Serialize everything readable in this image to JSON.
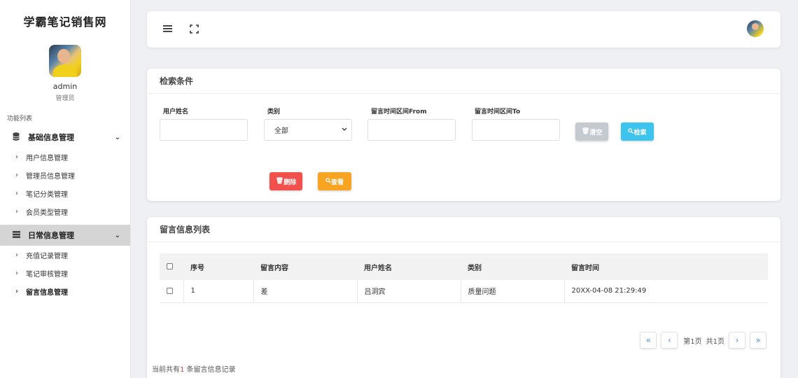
{
  "brand": "学霸笔记销售网",
  "user": {
    "name": "admin",
    "role": "管理员"
  },
  "menu_caption": "功能列表",
  "menu": {
    "groups": [
      {
        "label": "基础信息管理",
        "icon": "database-icon",
        "items": [
          "用户信息管理",
          "管理员信息管理",
          "笔记分类管理",
          "会员类型管理"
        ]
      },
      {
        "label": "日常信息管理",
        "icon": "server-icon",
        "items": [
          "充值记录管理",
          "笔记审核管理",
          "留言信息管理"
        ]
      }
    ],
    "active_item": "留言信息管理"
  },
  "search": {
    "title": "检索条件",
    "fields": [
      {
        "label": "用户姓名",
        "value": ""
      },
      {
        "label": "类别",
        "value": "全部"
      },
      {
        "label": "留言时间区间From",
        "value": ""
      },
      {
        "label": "留言时间区间To",
        "value": ""
      }
    ],
    "buttons": {
      "clear": "清空",
      "search": "检索",
      "delete": "删除",
      "view": "查看"
    }
  },
  "list": {
    "title": "留言信息列表",
    "columns": [
      "序号",
      "留言内容",
      "用户姓名",
      "类别",
      "留言时间"
    ],
    "rows": [
      {
        "id": "1",
        "content": "差",
        "user": "吕洞宾",
        "category": "质量问题",
        "time": "20XX-04-08 21:29:49"
      }
    ],
    "pager": {
      "current": "第1页",
      "total": "共1页"
    },
    "summary": {
      "prefix": "当前共有",
      "count": "1",
      "suffix": " 条留言信息记录"
    }
  }
}
